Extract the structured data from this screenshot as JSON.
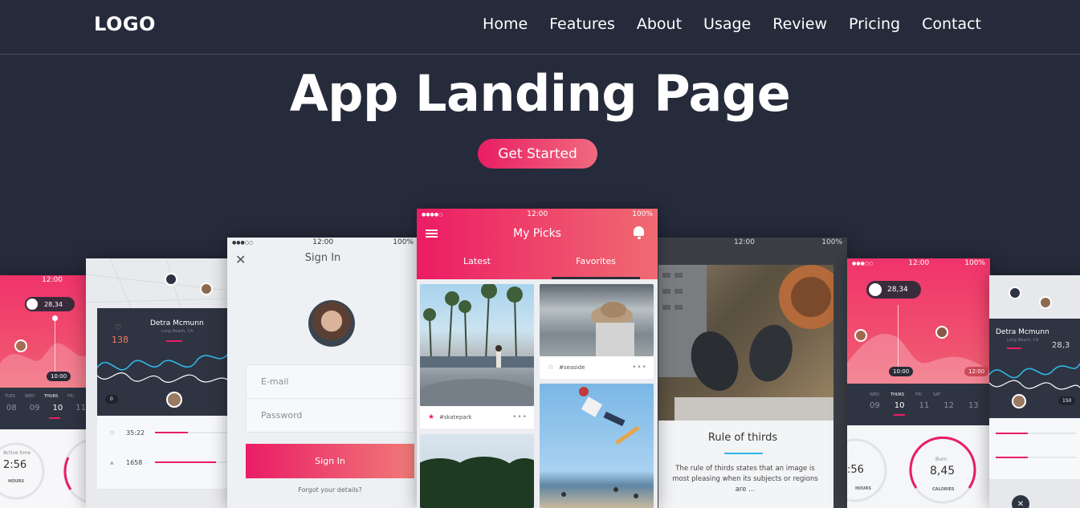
{
  "brand": {
    "logo": "LOGO"
  },
  "nav": [
    "Home",
    "Features",
    "About",
    "Usage",
    "Review",
    "Pricing",
    "Contact"
  ],
  "hero": {
    "title": "App Landing Page",
    "cta": "Get Started"
  },
  "screens": {
    "far_left": {
      "time": "12:00",
      "bubble": "28,34",
      "pin_time": "10:00",
      "days": [
        "TUES",
        "WED",
        "THURS",
        "FRI"
      ],
      "dates": [
        "08",
        "09",
        "10",
        "11"
      ],
      "active_label": "Active time",
      "active_value": "2:56",
      "active_unit": "HOURS"
    },
    "map_left": {
      "name": "Detra Mcmunn",
      "location": "Long Beach, CA",
      "likes": "138",
      "zero": "0",
      "stat1": "35:22",
      "stat2": "1658"
    },
    "signin": {
      "time": "12:00",
      "battery": "100%",
      "title": "Sign In",
      "email_placeholder": "E-mail",
      "password_placeholder": "Password",
      "button": "Sign In",
      "forgot": "Forgot your details?"
    },
    "center": {
      "time": "12:00",
      "battery": "100%",
      "title": "My Picks",
      "tabs": [
        "Latest",
        "Favorites"
      ],
      "tag1": "#skatepark",
      "tag2": "#seaside"
    },
    "rotated": {
      "time": "12:00",
      "battery": "100%",
      "heading": "Rule of thirds",
      "body": "The rule of thirds states that an image is most pleasing when its subjects or regions are ..."
    },
    "right": {
      "time": "12:00",
      "battery": "100%",
      "bubble": "28,34",
      "pin_time": "10:00",
      "pin_time2": "12:00",
      "days": [
        "WED",
        "THURS",
        "FRI",
        "SAT"
      ],
      "dates": [
        "09",
        "10",
        "11",
        "12",
        "13"
      ],
      "active_value": ":56",
      "active_unit": "HOURS",
      "burn_label": "Burn",
      "burn_value": "8,45",
      "burn_unit": "CALORIES"
    },
    "far_right": {
      "name": "Detra Mcmunn",
      "location": "Long Beach, CA",
      "stat": "28,3",
      "count": "150"
    }
  },
  "colors": {
    "bg": "#262b3b",
    "accent": "#e91e63",
    "accent2": "#f06a7e"
  }
}
